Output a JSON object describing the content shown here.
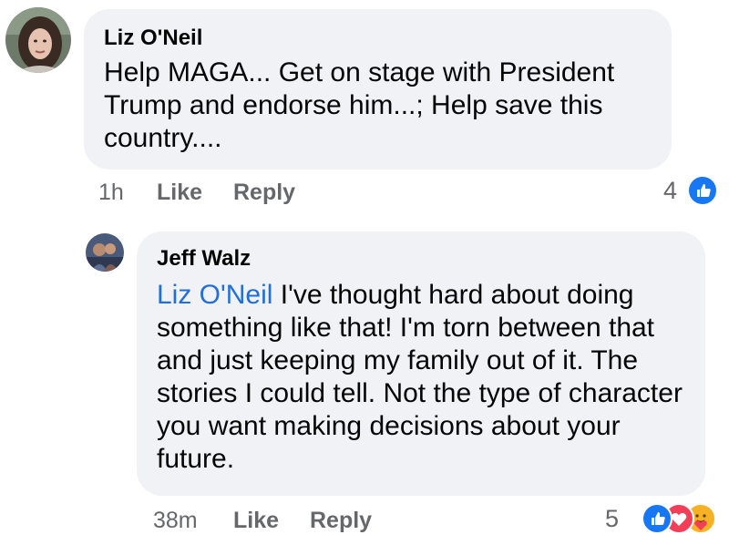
{
  "comments": [
    {
      "author": "Liz O'Neil",
      "text": "Help MAGA... Get on stage with President Trump and endorse him...; Help save this country....",
      "time": "1h",
      "like_label": "Like",
      "reply_label": "Reply",
      "reaction_count": "4",
      "reactions": [
        "like-icon"
      ]
    },
    {
      "author": "Jeff Walz",
      "mention": "Liz O'Neil",
      "text": "I've thought hard about doing something like that! I'm torn between that and just keeping my family out of it. The stories I could tell. Not the type of character you want making decisions about your future.",
      "time": "38m",
      "like_label": "Like",
      "reply_label": "Reply",
      "reaction_count": "5",
      "reactions": [
        "like-icon",
        "love-icon",
        "care-icon"
      ]
    }
  ],
  "colors": {
    "bubble": "#f0f2f5",
    "mention": "#216fdb",
    "meta": "#65676b",
    "like": "#1877f2",
    "love": "#f33e58",
    "care": "#f7b125"
  }
}
